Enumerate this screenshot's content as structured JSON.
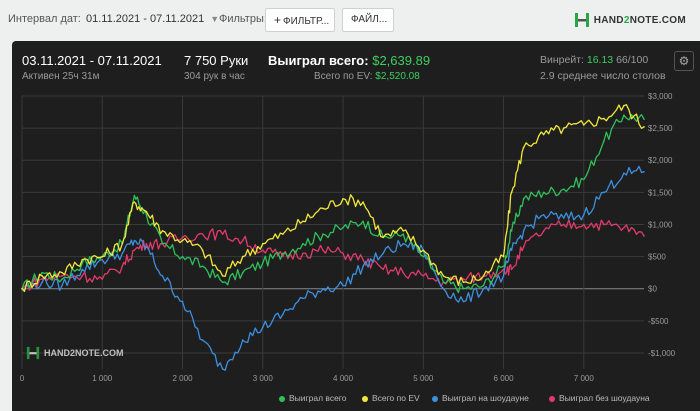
{
  "filters_bar": {
    "interval_label": "Интервал дат:",
    "interval_value": "01.11.2021 - 07.11.2021",
    "filters_label": "Фильтры:",
    "filter_button": "ФИЛЬТР...",
    "file_button": "ФАЙЛ...",
    "logo_text_a": "HAND",
    "logo_text_b": "2",
    "logo_text_c": "NOTE.COM"
  },
  "summary": {
    "date_range": "03.11.2021 - 07.11.2021",
    "active": "Активен 25ч 31м",
    "hands": "7 750 Руки",
    "hands_per_hour": "304 рук в час",
    "won_total_label": "Выиграл всего:",
    "won_total_value": "$2,639.89",
    "ev_label": "Всего по EV:",
    "ev_value": "$2,520.08",
    "winrate_label": "Винрейт:",
    "winrate_value": "16.13",
    "winrate_rest": "66/100",
    "tables": "2.9 среднее число столов"
  },
  "watermark": "HAND2NOTE.COM",
  "colors": {
    "won_total": "#2ec15a",
    "ev": "#f0e83a",
    "showdown": "#3d8fe0",
    "non_showdown": "#e23a6a",
    "grid": "#3a3a3a",
    "zero": "#888888"
  },
  "chart_data": {
    "type": "line",
    "xlim": [
      0,
      7750
    ],
    "ylim": [
      -1250,
      3000
    ],
    "x_ticks": [
      "0",
      "1 000",
      "2 000",
      "3 000",
      "4 000",
      "5 000",
      "6 000",
      "7 000"
    ],
    "y_ticks": [
      "$3,000",
      "$2,500",
      "$2,000",
      "$1,500",
      "$1,000",
      "$500",
      "$0",
      "-$500",
      "-$1,000"
    ],
    "x": [
      0,
      250,
      500,
      750,
      1000,
      1250,
      1400,
      1550,
      1750,
      2000,
      2250,
      2500,
      2750,
      3000,
      3250,
      3500,
      3750,
      4000,
      4250,
      4500,
      4750,
      5000,
      5250,
      5500,
      5750,
      6000,
      6100,
      6250,
      6500,
      6750,
      7000,
      7250,
      7500,
      7750
    ],
    "series": [
      {
        "name": "Выиграл всего",
        "color": "#2ec15a",
        "values": [
          0,
          250,
          150,
          400,
          500,
          700,
          1450,
          1150,
          700,
          500,
          350,
          100,
          250,
          400,
          550,
          700,
          850,
          950,
          1050,
          800,
          850,
          500,
          100,
          0,
          50,
          350,
          900,
          1400,
          1500,
          1550,
          1700,
          2300,
          2700,
          2640
        ]
      },
      {
        "name": "Всего по EV",
        "color": "#f0e83a",
        "values": [
          0,
          200,
          250,
          450,
          500,
          700,
          1350,
          1200,
          900,
          750,
          600,
          200,
          500,
          700,
          850,
          1050,
          1250,
          1400,
          1350,
          800,
          900,
          600,
          200,
          100,
          200,
          500,
          1500,
          2200,
          2400,
          2500,
          2550,
          2650,
          2850,
          2520
        ]
      },
      {
        "name": "Выиграл на шоудауне",
        "color": "#3d8fe0",
        "values": [
          0,
          100,
          50,
          300,
          450,
          550,
          750,
          650,
          200,
          -200,
          -800,
          -1250,
          -800,
          -600,
          -400,
          -150,
          0,
          50,
          350,
          550,
          700,
          600,
          0,
          -200,
          0,
          200,
          600,
          900,
          1150,
          1100,
          1150,
          1500,
          1800,
          1820
        ]
      },
      {
        "name": "Выиграл без шоудауна",
        "color": "#e23a6a",
        "values": [
          0,
          150,
          200,
          200,
          150,
          350,
          600,
          700,
          700,
          800,
          850,
          850,
          750,
          600,
          500,
          550,
          600,
          550,
          450,
          300,
          250,
          200,
          100,
          150,
          200,
          300,
          300,
          650,
          900,
          1000,
          1000,
          1000,
          950,
          820
        ]
      }
    ]
  }
}
